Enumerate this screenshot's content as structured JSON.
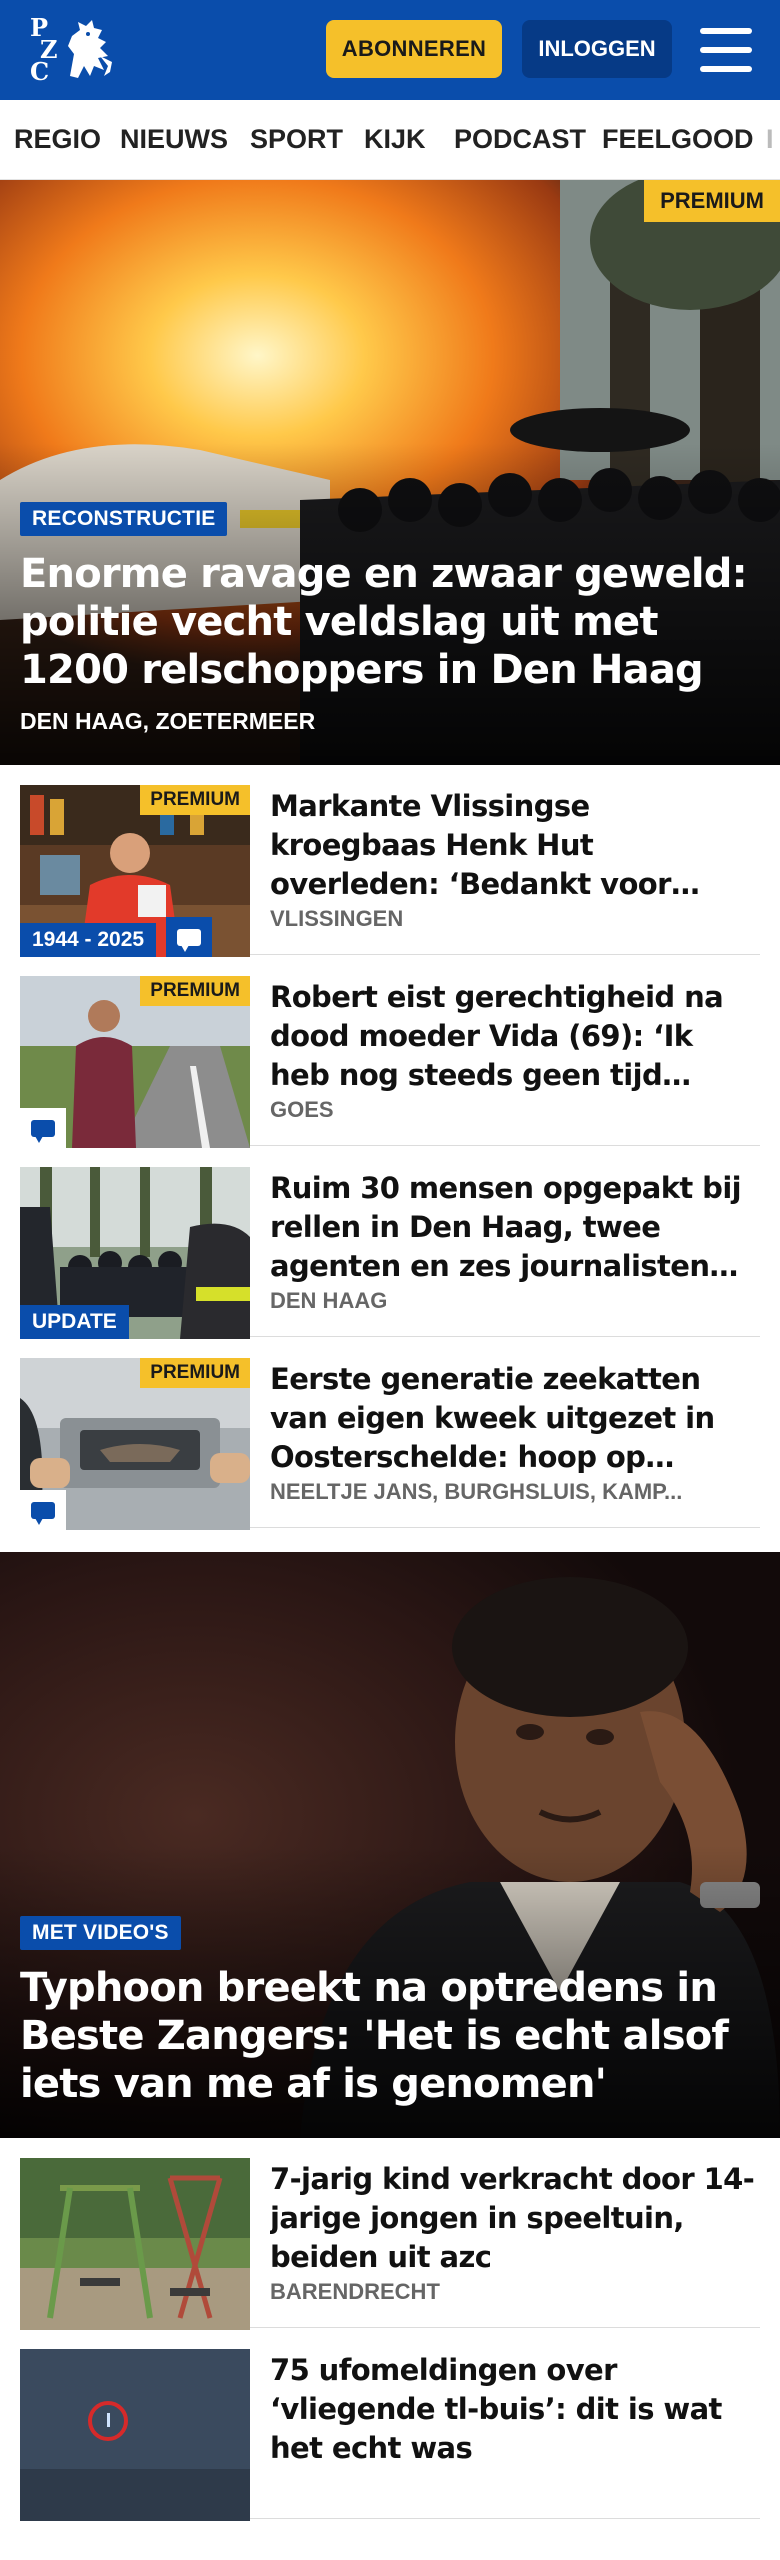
{
  "header": {
    "logo_letters": [
      "P",
      "Z",
      "C"
    ],
    "subscribe_label": "ABONNEREN",
    "login_label": "INLOGGEN",
    "menu_icon": "hamburger-menu-icon",
    "colors": {
      "brand_blue": "#0a4dab",
      "accent_yellow": "#f5c02a"
    }
  },
  "nav": {
    "items": [
      "REGIO",
      "NIEUWS",
      "SPORT",
      "KIJK",
      "PODCAST",
      "FEELGOOD",
      "I"
    ]
  },
  "hero1": {
    "premium": "PREMIUM",
    "tag": "RECONSTRUCTIE",
    "title": "Enorme ravage en zwaar geweld: politie vecht veldslag uit met 1200 relschoppers in Den Haag",
    "location": "DEN HAAG, ZOETERMEER"
  },
  "articles": [
    {
      "premium": "PREMIUM",
      "badge": "1944 - 2025",
      "comment_icon": "comment-icon",
      "title": "Markante Vlissingse kroegbaas Henk Hut overleden: ‘Bedankt voor alles’",
      "location": "VLISSINGEN"
    },
    {
      "premium": "PREMIUM",
      "comment_icon": "comment-icon",
      "title": "Robert eist gerechtigheid na dood moeder Vida (69): ‘Ik heb nog steeds geen tijd gehad om t...",
      "location": "GOES"
    },
    {
      "badge": "UPDATE",
      "title": "Ruim 30 mensen opgepakt bij rellen in Den Haag, twee agenten en zes journalisten gewond",
      "location": "DEN HAAG"
    },
    {
      "premium": "PREMIUM",
      "comment_icon": "comment-icon",
      "title": "Eerste generatie zeekatten van eigen kweek uitgezet in Ooster­schelde: hoop op terugkeer...",
      "location": "NEELTJE JANS, BURGHSLUIS, KAMP..."
    }
  ],
  "hero2": {
    "tag": "MET VIDEO'S",
    "title": "Typhoon breekt na optredens in Beste Zangers: 'Het is echt alsof iets van me af is genomen'"
  },
  "articles2": [
    {
      "title": "7-jarig kind verkracht door 14-jarige jongen in speeltuin, beiden uit azc",
      "location": "BARENDRECHT"
    },
    {
      "title": "75 ufomeldingen over ‘vliegende tl-buis’: dit is wat het echt was"
    }
  ]
}
